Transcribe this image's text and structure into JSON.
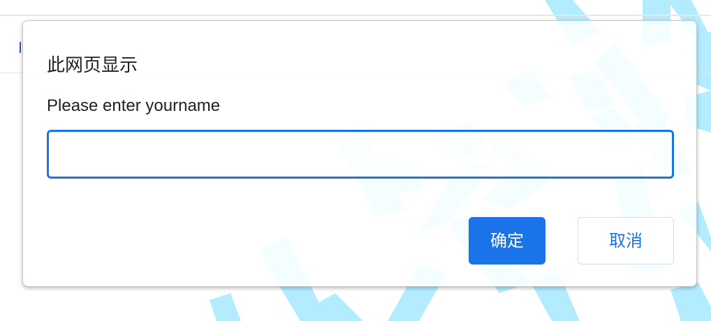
{
  "dialog": {
    "title": "此网页显示",
    "message": "Please enter yourname",
    "input_value": "",
    "ok_label": "确定",
    "cancel_label": "取消"
  },
  "colors": {
    "accent": "#1a73e8",
    "watermark": "#b3ecff",
    "text": "#202124",
    "button_text_light": "#ffffff"
  }
}
